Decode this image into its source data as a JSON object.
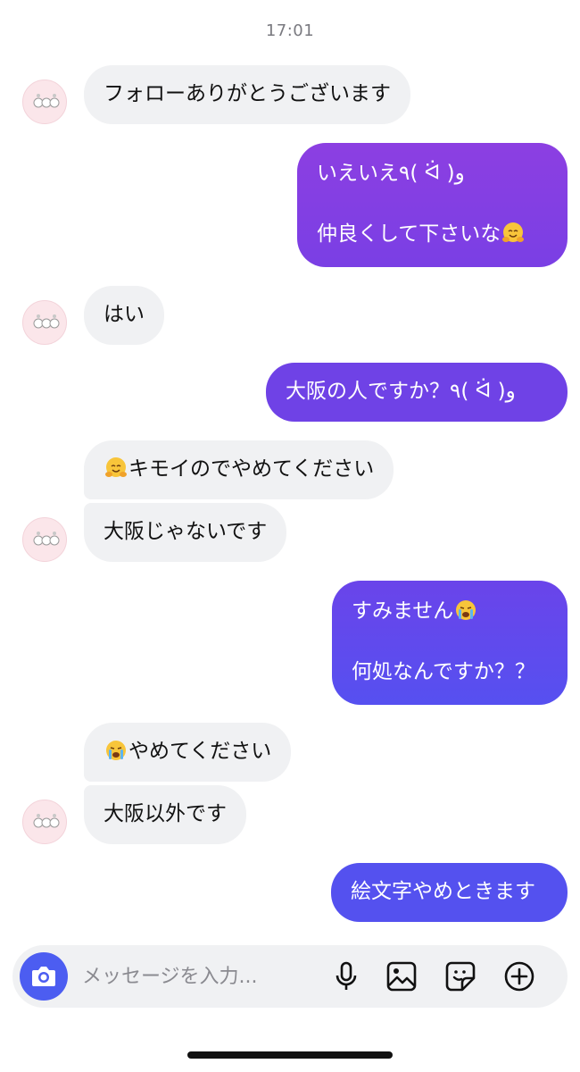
{
  "chat": {
    "timestamp": "17:01",
    "messages": [
      {
        "sender": "other",
        "text": "フォローありがとうございます"
      },
      {
        "sender": "me",
        "line1": "いえいえ٩( ᐛ )و",
        "line2": "仲良くして下さいな",
        "emoji": "hugging-face"
      },
      {
        "sender": "other",
        "text": "はい"
      },
      {
        "sender": "me",
        "text": "大阪の人ですか？٩( ᐛ )و"
      },
      {
        "sender": "other",
        "emoji": "hugging-face",
        "text": "キモイのでやめてください"
      },
      {
        "sender": "other",
        "text": "大阪じゃないです"
      },
      {
        "sender": "me",
        "line1": "すみません",
        "emoji": "loudly-crying-face",
        "line2": "何処なんですか？？"
      },
      {
        "sender": "other",
        "emoji": "loudly-crying-face",
        "text": "やめてください"
      },
      {
        "sender": "other",
        "text": "大阪以外です"
      },
      {
        "sender": "me",
        "text": "絵文字やめときます"
      }
    ]
  },
  "composer": {
    "placeholder": "メッセージを入力...",
    "icons": [
      "camera-icon",
      "microphone-icon",
      "image-icon",
      "sticker-icon",
      "add-circle-icon"
    ]
  },
  "colors": {
    "incoming_bubble": "#f0f1f3",
    "outgoing_gradient_top": "#8a3fe0",
    "outgoing_gradient_bottom": "#4f57f0",
    "camera_button": "#4c5df1"
  }
}
